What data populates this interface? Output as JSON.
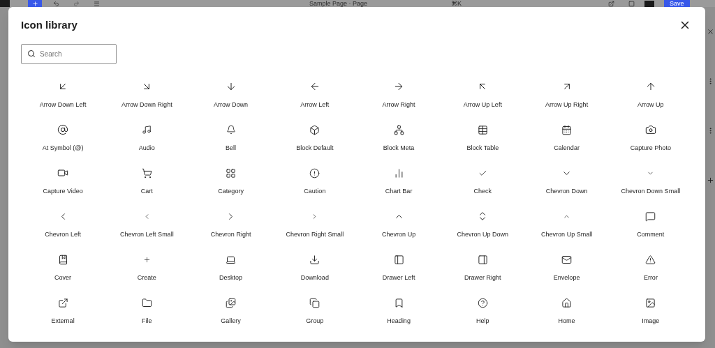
{
  "editor_bar": {
    "document_title": "Sample Page · Page",
    "shortcut": "⌘K",
    "save_button": "Save"
  },
  "modal": {
    "title": "Icon library",
    "search": {
      "placeholder": "Search"
    },
    "icons": [
      {
        "label": "Arrow Down Left"
      },
      {
        "label": "Arrow Down Right"
      },
      {
        "label": "Arrow Down"
      },
      {
        "label": "Arrow Left"
      },
      {
        "label": "Arrow Right"
      },
      {
        "label": "Arrow Up Left"
      },
      {
        "label": "Arrow Up Right"
      },
      {
        "label": "Arrow Up"
      },
      {
        "label": "At Symbol (@)"
      },
      {
        "label": "Audio"
      },
      {
        "label": "Bell"
      },
      {
        "label": "Block Default"
      },
      {
        "label": "Block Meta"
      },
      {
        "label": "Block Table"
      },
      {
        "label": "Calendar"
      },
      {
        "label": "Capture Photo"
      },
      {
        "label": "Capture Video"
      },
      {
        "label": "Cart"
      },
      {
        "label": "Category"
      },
      {
        "label": "Caution"
      },
      {
        "label": "Chart Bar"
      },
      {
        "label": "Check"
      },
      {
        "label": "Chevron Down"
      },
      {
        "label": "Chevron Down Small"
      },
      {
        "label": "Chevron Left"
      },
      {
        "label": "Chevron Left Small"
      },
      {
        "label": "Chevron Right"
      },
      {
        "label": "Chevron Right Small"
      },
      {
        "label": "Chevron Up"
      },
      {
        "label": "Chevron Up Down"
      },
      {
        "label": "Chevron Up Small"
      },
      {
        "label": "Comment"
      },
      {
        "label": "Cover"
      },
      {
        "label": "Create"
      },
      {
        "label": "Desktop"
      },
      {
        "label": "Download"
      },
      {
        "label": "Drawer Left"
      },
      {
        "label": "Drawer Right"
      },
      {
        "label": "Envelope"
      },
      {
        "label": "Error"
      },
      {
        "label": "External"
      },
      {
        "label": "File"
      },
      {
        "label": "Gallery"
      },
      {
        "label": "Group"
      },
      {
        "label": "Heading"
      },
      {
        "label": "Help"
      },
      {
        "label": "Home"
      },
      {
        "label": "Image"
      }
    ]
  }
}
